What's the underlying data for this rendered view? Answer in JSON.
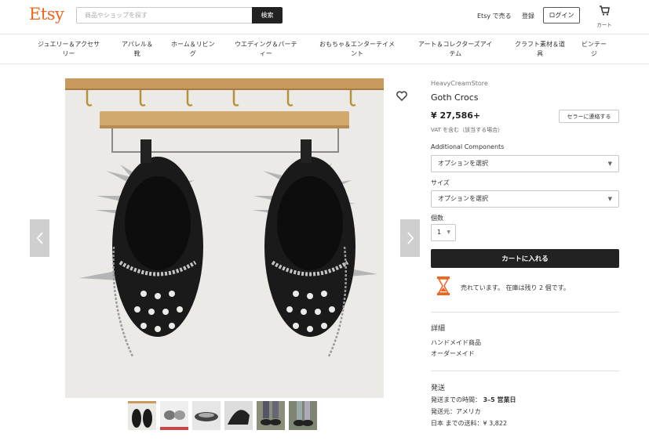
{
  "header": {
    "logo": "Etsy",
    "search_placeholder": "商品やショップを探す",
    "search_button": "検索",
    "sell_link": "Etsy で売る",
    "register_link": "登録",
    "login_button": "ログイン",
    "cart_label": "カート",
    "accent_color": "#f1641e"
  },
  "categories": [
    {
      "line1": "ジュエリー＆アクセサ",
      "line2": "リー"
    },
    {
      "line1": "アパレル＆",
      "line2": "靴"
    },
    {
      "line1": "ホーム＆リビン",
      "line2": "グ"
    },
    {
      "line1": "ウエディング＆パーテ",
      "line2": "ィー"
    },
    {
      "line1": "おもちゃ＆エンターテイメ",
      "line2": "ント"
    },
    {
      "line1": "アート＆コレクターズアイ",
      "line2": "テム"
    },
    {
      "line1": "クラフト素材＆道",
      "line2": "具"
    },
    {
      "line1": "ビンテー",
      "line2": "ジ"
    }
  ],
  "product": {
    "shop_name": "HeavyCreamStore",
    "title": "Goth Crocs",
    "price": "¥ 27,586+",
    "vat_note": "VAT を含む（該当する場合）",
    "contact_seller": "セラーに連絡する",
    "components_label": "Additional Components",
    "components_select": "オプションを選択",
    "size_label": "サイズ",
    "size_select": "オプションを選択",
    "quantity_label": "個数",
    "quantity_value": "1",
    "add_to_cart": "カートに入れる",
    "stock_message": "売れています。 在庫は残り 2 個です。"
  },
  "details": {
    "title": "詳細",
    "lines": [
      "ハンドメイド商品",
      "オーダーメイド"
    ]
  },
  "shipping": {
    "title": "発送",
    "time_label": "発送までの時間：",
    "time_value": "3–5 営業日",
    "origin": "発送元：アメリカ",
    "cost": "日本 までの送料：¥ 3,822"
  },
  "icons": {
    "heart": "heart-icon",
    "cart": "cart-icon",
    "prev": "chevron-left-icon",
    "next": "chevron-right-icon",
    "stock": "hourglass-icon"
  }
}
